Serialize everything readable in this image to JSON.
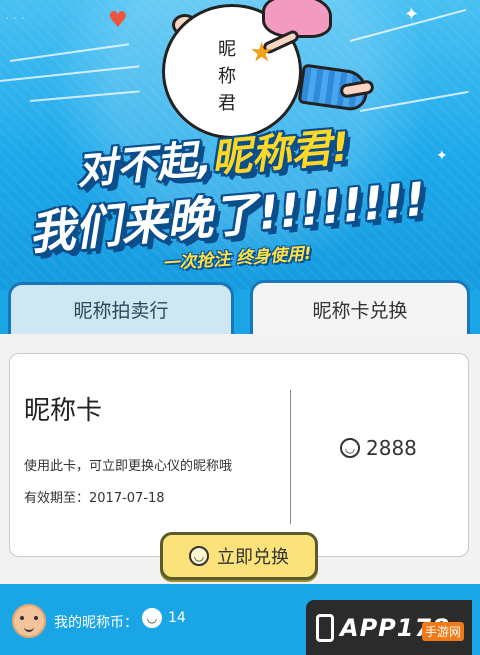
{
  "banner": {
    "ball_text": [
      "昵",
      "称",
      "君"
    ],
    "headline_line1_a": "对不起,",
    "headline_line1_b": "昵称君!",
    "headline_line2": "我们来晚了!!!!!!!!",
    "tagline": "一次抢注 终身使用!"
  },
  "tabs": [
    {
      "label": "昵称拍卖行",
      "active": false
    },
    {
      "label": "昵称卡兑换",
      "active": true
    }
  ],
  "card": {
    "title": "昵称卡",
    "description": "使用此卡，可立即更换心仪的昵称哦",
    "expiry": "有效期至：2017-07-18",
    "price": "2888",
    "coin_icon": "coin-icon"
  },
  "redeem_button": {
    "label": "立即兑换"
  },
  "footer": {
    "balance_label": "我的昵称币：",
    "balance_value": "14"
  },
  "watermark": {
    "text": "APP178",
    "sub": "手游网"
  },
  "colors": {
    "background": "#1aa6e6",
    "accent_yellow": "#ffd826",
    "button_yellow": "#fbe27a"
  }
}
